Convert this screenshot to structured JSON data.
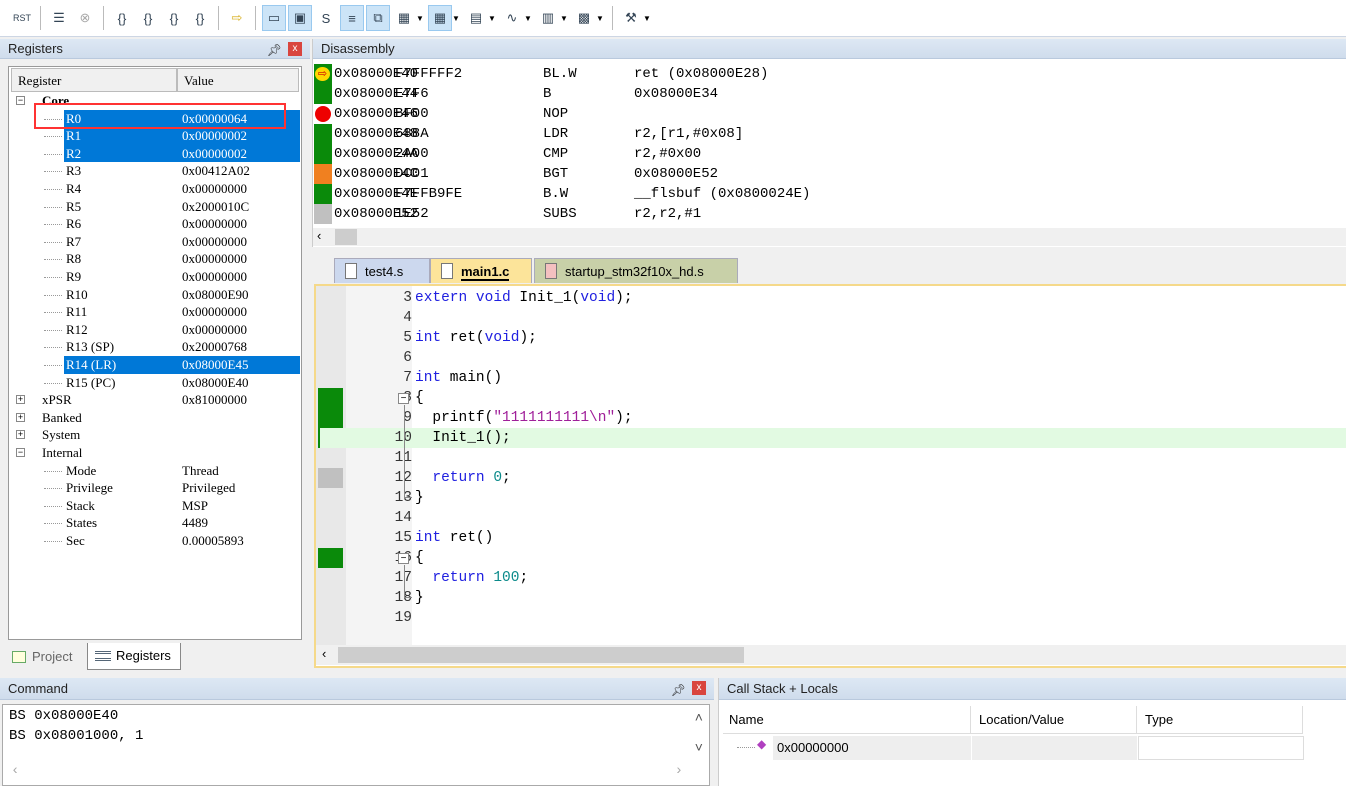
{
  "toolbar": {
    "buttons": [
      {
        "icon": "reset-icon",
        "label": "RST"
      },
      {
        "icon": "run-icon"
      },
      {
        "icon": "stop-icon"
      },
      {
        "icon": "step-into-icon",
        "label": "{}"
      },
      {
        "icon": "step-over-icon",
        "label": "{}"
      },
      {
        "icon": "step-out-icon",
        "label": "{}"
      },
      {
        "icon": "run-to-cursor-icon",
        "label": "{}"
      },
      {
        "icon": "show-next-statement-icon"
      },
      {
        "icon": "command-window-icon"
      },
      {
        "icon": "disassembly-window-icon"
      },
      {
        "icon": "symbols-window-icon"
      },
      {
        "icon": "registers-window-icon"
      },
      {
        "icon": "call-stack-window-icon"
      },
      {
        "icon": "watch-window-icon"
      },
      {
        "icon": "memory-window-icon"
      },
      {
        "icon": "serial-window-icon"
      },
      {
        "icon": "analysis-window-icon"
      },
      {
        "icon": "trace-window-icon"
      },
      {
        "icon": "system-viewer-icon"
      },
      {
        "icon": "toolbox-icon"
      }
    ]
  },
  "registers": {
    "title": "Registers",
    "col_register": "Register",
    "col_value": "Value",
    "rows": [
      {
        "name": "Core",
        "value": "",
        "level": 0,
        "expander": "-",
        "bold": true
      },
      {
        "name": "R0",
        "value": "0x00000064",
        "level": 2,
        "selected": true
      },
      {
        "name": "R1",
        "value": "0x00000002",
        "level": 2,
        "selected": true
      },
      {
        "name": "R2",
        "value": "0x00000002",
        "level": 2,
        "selected": true
      },
      {
        "name": "R3",
        "value": "0x00412A02",
        "level": 2
      },
      {
        "name": "R4",
        "value": "0x00000000",
        "level": 2
      },
      {
        "name": "R5",
        "value": "0x2000010C",
        "level": 2
      },
      {
        "name": "R6",
        "value": "0x00000000",
        "level": 2
      },
      {
        "name": "R7",
        "value": "0x00000000",
        "level": 2
      },
      {
        "name": "R8",
        "value": "0x00000000",
        "level": 2
      },
      {
        "name": "R9",
        "value": "0x00000000",
        "level": 2
      },
      {
        "name": "R10",
        "value": "0x08000E90",
        "level": 2
      },
      {
        "name": "R11",
        "value": "0x00000000",
        "level": 2
      },
      {
        "name": "R12",
        "value": "0x00000000",
        "level": 2
      },
      {
        "name": "R13 (SP)",
        "value": "0x20000768",
        "level": 2
      },
      {
        "name": "R14 (LR)",
        "value": "0x08000E45",
        "level": 2,
        "selected": true
      },
      {
        "name": "R15 (PC)",
        "value": "0x08000E40",
        "level": 2
      },
      {
        "name": "xPSR",
        "value": "0x81000000",
        "level": 1,
        "expander": "+"
      },
      {
        "name": "Banked",
        "value": "",
        "level": 0,
        "expander": "+"
      },
      {
        "name": "System",
        "value": "",
        "level": 0,
        "expander": "+"
      },
      {
        "name": "Internal",
        "value": "",
        "level": 0,
        "expander": "-"
      },
      {
        "name": "Mode",
        "value": "Thread",
        "level": 2
      },
      {
        "name": "Privilege",
        "value": "Privileged",
        "level": 2
      },
      {
        "name": "Stack",
        "value": "MSP",
        "level": 2
      },
      {
        "name": "States",
        "value": "4489",
        "level": 2
      },
      {
        "name": "Sec",
        "value": "0.00005893",
        "level": 2
      }
    ],
    "highlight_color": "#ff3333"
  },
  "left_tabs": [
    {
      "label": "Project",
      "active": false
    },
    {
      "label": "Registers",
      "active": true
    }
  ],
  "disassembly": {
    "title": "Disassembly",
    "lines": [
      {
        "addr": "0x08000E40",
        "code": "F7FFFFF2",
        "mn": "BL.W",
        "ops": "ret (0x08000E28)",
        "marker": "current",
        "gutter": "#0a8a0a"
      },
      {
        "addr": "0x08000E44",
        "code": "E7F6",
        "mn": "B",
        "ops": "0x08000E34",
        "gutter": "#0a8a0a"
      },
      {
        "addr": "0x08000E46",
        "code": "BF00",
        "mn": "NOP",
        "ops": "",
        "marker": "breakpoint",
        "gutter": "#ffffff"
      },
      {
        "addr": "0x08000E48",
        "code": "688A",
        "mn": "LDR",
        "ops": "r2,[r1,#0x08]",
        "gutter": "#0a8a0a"
      },
      {
        "addr": "0x08000E4A",
        "code": "2A00",
        "mn": "CMP",
        "ops": "r2,#0x00",
        "gutter": "#0a8a0a"
      },
      {
        "addr": "0x08000E4C",
        "code": "DC01",
        "mn": "BGT",
        "ops": "0x08000E52",
        "gutter": "#f08020"
      },
      {
        "addr": "0x08000E4E",
        "code": "F7FFB9FE",
        "mn": "B.W",
        "ops": "__flsbuf (0x0800024E)",
        "gutter": "#0a8a0a"
      },
      {
        "addr": "0x08000E52",
        "code": "1E52",
        "mn": "SUBS",
        "ops": "r2,r2,#1",
        "gutter": "#c0c0c0"
      }
    ]
  },
  "editor": {
    "tabs": [
      {
        "label": "test4.s",
        "active": false
      },
      {
        "label": "main1.c",
        "active": true
      },
      {
        "label": "startup_stm32f10x_hd.s",
        "active": false
      }
    ],
    "lines": [
      {
        "n": "3",
        "html": "<span class='kw'>extern void</span> Init_1(<span class='kw'>void</span>);"
      },
      {
        "n": "4",
        "html": ""
      },
      {
        "n": "5",
        "html": "<span class='kw'>int</span> ret(<span class='kw'>void</span>);"
      },
      {
        "n": "6",
        "html": ""
      },
      {
        "n": "7",
        "html": "<span class='kw'>int</span> main()"
      },
      {
        "n": "8",
        "html": "{",
        "fold": true,
        "gutter": "#0a8a0a"
      },
      {
        "n": "9",
        "html": "  printf(<span class='str'>\"1111111111\\n\"</span>);",
        "gutter": "#0a8a0a"
      },
      {
        "n": "10",
        "html": "  Init_1();",
        "gutter": "#0a8a0a",
        "current": true
      },
      {
        "n": "11",
        "html": ""
      },
      {
        "n": "12",
        "html": "  <span class='kw'>return</span> <span class='num'>0</span>;",
        "gutter": "#c0c0c0"
      },
      {
        "n": "13",
        "html": "}"
      },
      {
        "n": "14",
        "html": ""
      },
      {
        "n": "15",
        "html": "<span class='kw'>int</span> ret()"
      },
      {
        "n": "16",
        "html": "{",
        "fold": true,
        "gutter": "#0a8a0a"
      },
      {
        "n": "17",
        "html": "  <span class='kw'>return</span> <span class='num'>100</span>;"
      },
      {
        "n": "18",
        "html": "}"
      },
      {
        "n": "19",
        "html": ""
      }
    ]
  },
  "command": {
    "title": "Command",
    "lines": [
      "BS 0x08000E40",
      "BS 0x08001000, 1"
    ]
  },
  "callstack": {
    "title": "Call Stack + Locals",
    "columns": [
      "Name",
      "Location/Value",
      "Type"
    ],
    "rows": [
      {
        "name": "0x00000000",
        "location": "",
        "type": ""
      }
    ]
  }
}
